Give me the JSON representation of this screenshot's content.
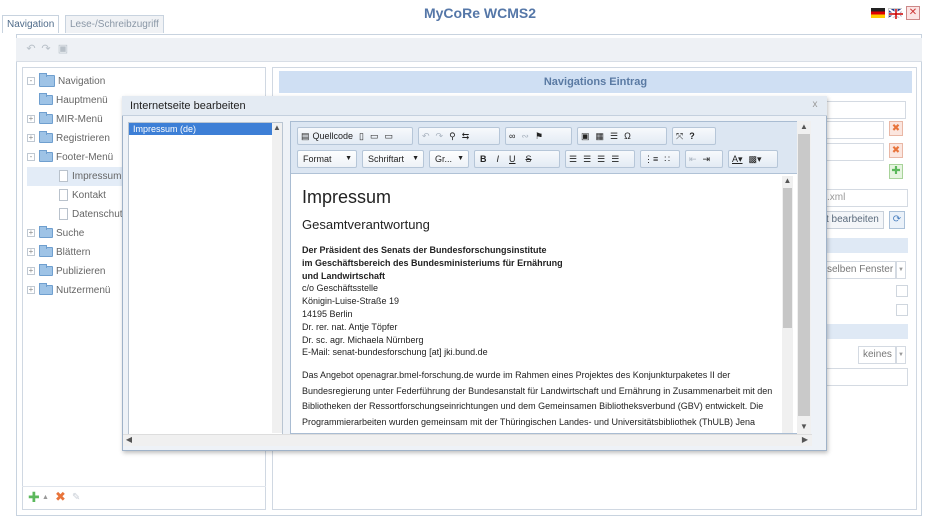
{
  "tabs": [
    {
      "label": "Navigation",
      "active": true
    },
    {
      "label": "Lese-/Schreibzugriff",
      "active": false
    }
  ],
  "app_title": "MyCoRe WCMS2",
  "languages": [
    "de-flag-icon",
    "en-flag-icon"
  ],
  "right_panel": {
    "header": "Navigations Eintrag",
    "file_field_value": ".xml",
    "edit_button_label": "t bearbeiten",
    "window_select_value": "selben Fenster",
    "style_select_value": "keines"
  },
  "tree": [
    {
      "label": "Navigation",
      "level": 0,
      "type": "folder",
      "expander": "-"
    },
    {
      "label": "Hauptmenü",
      "level": 1,
      "type": "folder",
      "expander": ""
    },
    {
      "label": "MIR-Menü",
      "level": 1,
      "type": "folder",
      "expander": "+"
    },
    {
      "label": "Registrieren",
      "level": 1,
      "type": "folder",
      "expander": "+"
    },
    {
      "label": "Footer-Menü",
      "level": 1,
      "type": "folder",
      "expander": "-"
    },
    {
      "label": "Impressum",
      "level": 2,
      "type": "page",
      "expander": "",
      "selected": true
    },
    {
      "label": "Kontakt",
      "level": 2,
      "type": "page",
      "expander": ""
    },
    {
      "label": "Datenschutz",
      "level": 2,
      "type": "page",
      "expander": ""
    },
    {
      "label": "Suche",
      "level": 1,
      "type": "folder",
      "expander": "+"
    },
    {
      "label": "Blättern",
      "level": 1,
      "type": "folder",
      "expander": "+"
    },
    {
      "label": "Publizieren",
      "level": 1,
      "type": "folder",
      "expander": "+"
    },
    {
      "label": "Nutzermenü",
      "level": 1,
      "type": "folder",
      "expander": "+"
    }
  ],
  "dialog": {
    "title": "Internetseite bearbeiten",
    "close_glyph": "x",
    "pages": [
      "Impressum (de)"
    ],
    "toolbar": {
      "source_label": "Quellcode",
      "format_label": "Format",
      "font_label": "Schriftart",
      "size_label": "Gr..."
    },
    "content": {
      "h1": "Impressum",
      "h2": "Gesamtverantwortung",
      "bold_lines": [
        "Der Präsident des Senats der Bundesforschungsinstitute",
        "im Geschäftsbereich des Bundesministeriums für Ernährung",
        "und Landwirtschaft"
      ],
      "lines": [
        "c/o Geschäftsstelle",
        "Königin-Luise-Straße 19",
        "14195 Berlin",
        "Dr. rer. nat. Antje Töpfer",
        "Dr. sc. agr. Michaela Nürnberg",
        "E-Mail: senat-bundesforschung [at] jki.bund.de"
      ],
      "paragraph": "Das Angebot openagrar.bmel-forschung.de wurde im Rahmen eines Projektes des Konjunkturpaketes II der Bundesregierung unter Federführung der Bundesanstalt für Landwirtschaft und Ernährung in Zusammenarbeit mit den Bibliotheken der Ressortforschungseinrichtungen und dem Gemeinsamen Bibliotheksverbund (GBV) entwickelt. Die Programmierarbeiten wurden gemeinsam mit der Thüringischen Landes- und Universitätsbibliothek (ThULB) Jena"
    }
  }
}
